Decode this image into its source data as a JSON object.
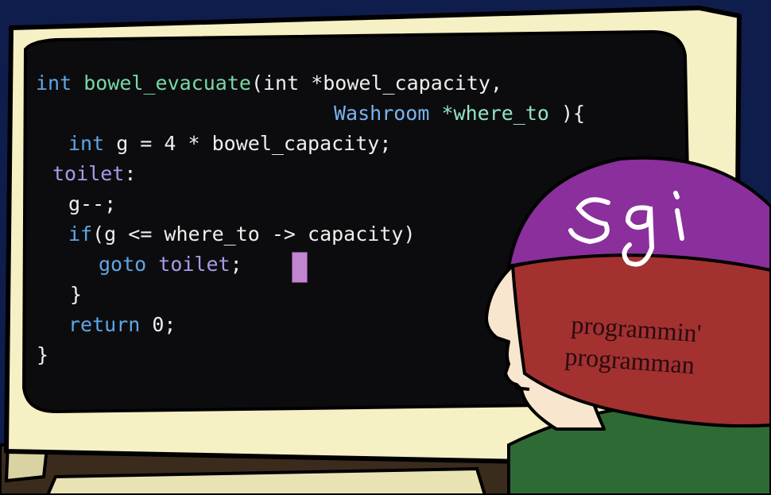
{
  "code": {
    "line1": {
      "kw": "int",
      "fn": "bowel_evacuate",
      "rest": "(int *bowel_capacity,"
    },
    "line2": {
      "ty": "Washroom",
      "id": "*where_to",
      "rest": " ){"
    },
    "line3": {
      "kw": "int",
      "rest": " g = 4 * bowel_capacity;"
    },
    "line4": {
      "label": "toilet",
      "rest": ":"
    },
    "line5": "g--;",
    "line6": {
      "kw": "if",
      "rest": "(g <= where_to -> capacity)"
    },
    "line7": {
      "kw": "goto",
      "label": "toilet",
      "rest": ";"
    },
    "line8": "}",
    "line9": {
      "kw": "return",
      "rest": " 0;"
    },
    "line10": "}"
  },
  "hat": {
    "logo": "sgi",
    "line1": "programmin'",
    "line2": "programman"
  },
  "colors": {
    "background": "#0f1d4d",
    "monitor_bezel": "#f6f0c5",
    "screen": "#0c0c0e",
    "beanie_top": "#8a2f9c",
    "beanie_band": "#a2312f",
    "skin": "#f8e6cf",
    "shirt": "#2e6b34",
    "keyword": "#5fa6e6",
    "function_name": "#76d9a6",
    "label": "#a89be6",
    "cursor": "#c285cf"
  }
}
